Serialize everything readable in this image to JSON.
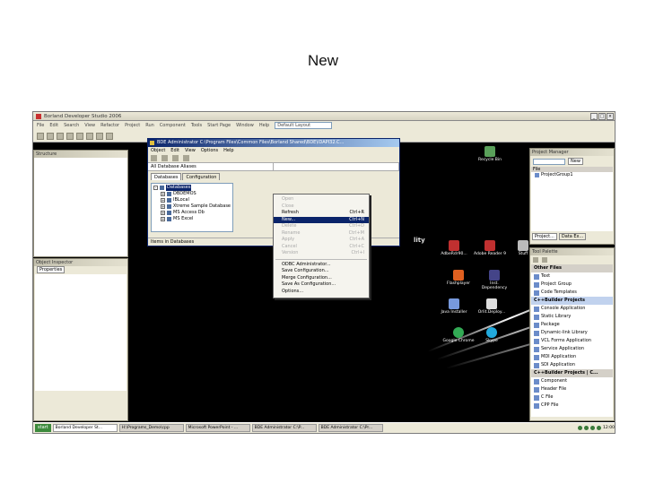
{
  "slide": {
    "title": "New"
  },
  "ide": {
    "title": "Borland Developer Studio 2006",
    "menu": [
      "File",
      "Edit",
      "Search",
      "View",
      "Refactor",
      "Project",
      "Run",
      "Component",
      "Tools",
      "Start Page",
      "Window",
      "Help"
    ],
    "layout_combo": "Default Layout",
    "left_panel_title": "Structure",
    "object_inspector_title": "Object Inspector",
    "object_inspector_tab": "Properties",
    "project_manager_title": "Project Manager",
    "project_new_label": "New",
    "project_file_header": "File",
    "project_group": "ProjectGroup1",
    "project_bottom_tabs": [
      "Project...",
      "Data Ex..."
    ],
    "tool_palette_title": "Tool Palette",
    "tool_palette_items": [
      {
        "label": "Other Files",
        "cat": true
      },
      {
        "label": "Text",
        "cat": false
      },
      {
        "label": "Project Group",
        "cat": false
      },
      {
        "label": "Code Templates",
        "cat": false
      },
      {
        "label": "C++Builder Projects",
        "cat": true,
        "hl": true
      },
      {
        "label": "Console Application",
        "cat": false
      },
      {
        "label": "Static Library",
        "cat": false
      },
      {
        "label": "Package",
        "cat": false
      },
      {
        "label": "Dynamic-link Library",
        "cat": false
      },
      {
        "label": "VCL Forms Application",
        "cat": false
      },
      {
        "label": "Service Application",
        "cat": false
      },
      {
        "label": "MDI Application",
        "cat": false
      },
      {
        "label": "SDI Application",
        "cat": false
      },
      {
        "label": "C++Builder Projects | C...",
        "cat": true
      },
      {
        "label": "Component",
        "cat": false
      },
      {
        "label": "Header File",
        "cat": false
      },
      {
        "label": "C File",
        "cat": false
      },
      {
        "label": "CPP File",
        "cat": false
      }
    ]
  },
  "bde": {
    "title": "BDE Administrator  C:\\Program Files\\Common Files\\Borland Shared\\BDE\\IDAPI32.C...",
    "menu": [
      "Object",
      "Edit",
      "View",
      "Options",
      "Help"
    ],
    "alias_label": "All Database Aliases",
    "tabs": [
      "Databases",
      "Configuration"
    ],
    "tree": [
      {
        "label": "Databases",
        "sel": true,
        "indent": 0,
        "node": "-"
      },
      {
        "label": "DBDEMOS",
        "sel": false,
        "indent": 1,
        "node": "+"
      },
      {
        "label": "IBLocal",
        "sel": false,
        "indent": 1,
        "node": "+"
      },
      {
        "label": "Xtreme Sample Database",
        "sel": false,
        "indent": 1,
        "node": "+"
      },
      {
        "label": "MS Access Db",
        "sel": false,
        "indent": 1,
        "node": "+"
      },
      {
        "label": "MS Excel",
        "sel": false,
        "indent": 1,
        "node": "+"
      }
    ],
    "status": "Items in Databases"
  },
  "context_menu": {
    "items": [
      {
        "label": "Open",
        "shortcut": "",
        "disabled": true
      },
      {
        "label": "Close",
        "shortcut": "",
        "disabled": true
      },
      {
        "label": "Refresh",
        "shortcut": "Ctrl+R",
        "disabled": false
      },
      {
        "label": "New...",
        "shortcut": "Ctrl+N",
        "disabled": false,
        "highlight": true
      },
      {
        "label": "Delete",
        "shortcut": "Ctrl+D",
        "disabled": true
      },
      {
        "label": "Rename",
        "shortcut": "Ctrl+M",
        "disabled": true
      },
      {
        "label": "Apply",
        "shortcut": "Ctrl+A",
        "disabled": true
      },
      {
        "label": "Cancel",
        "shortcut": "Ctrl+C",
        "disabled": true
      },
      {
        "label": "Version",
        "shortcut": "Ctrl+I",
        "disabled": true
      }
    ],
    "items2": [
      {
        "label": "ODBC Administrator..."
      },
      {
        "label": "Save Configuration..."
      },
      {
        "label": "Merge Configuration..."
      },
      {
        "label": "Save As Configuration..."
      },
      {
        "label": "Options..."
      }
    ]
  },
  "desktop": {
    "icons": [
      {
        "label": "Recycle Bin",
        "color": "#5aa05a"
      },
      {
        "label": "AdbeRdr90...",
        "color": "#c03030"
      },
      {
        "label": "Adobe Reader 9",
        "color": "#c03030"
      },
      {
        "label": "Stuff",
        "color": "#bbbbbb"
      },
      {
        "label": "Flashplayer",
        "color": "#e06020"
      },
      {
        "label": "Inst. Dependency",
        "color": "#444488"
      },
      {
        "label": "Java Installer",
        "color": "#7799dd"
      },
      {
        "label": "Orlit.Deploy...",
        "color": "#dddddd"
      },
      {
        "label": "Google Chrome",
        "color": "#33aa55"
      },
      {
        "label": "Skype",
        "color": "#22aadd"
      }
    ],
    "background_text": "lity"
  },
  "taskbar": {
    "start": "start",
    "tasks": [
      {
        "label": "Borland Developer St...",
        "active": true
      },
      {
        "label": "H:\\Programs_Demo\\cpp",
        "active": false
      },
      {
        "label": "Microsoft PowerPoint - ...",
        "active": false
      },
      {
        "label": "BDE Administrator  C:\\P...",
        "active": false
      },
      {
        "label": "BDE Administrator  C:\\Pr...",
        "active": false
      }
    ],
    "clock": "12:00"
  }
}
